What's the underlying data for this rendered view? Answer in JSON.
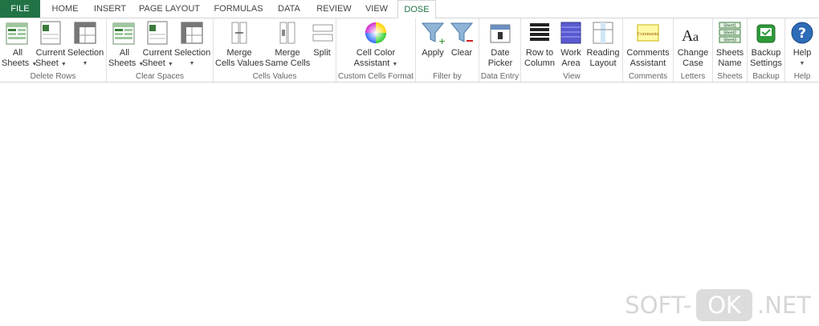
{
  "tabs": {
    "file": "FILE",
    "home": "HOME",
    "insert": "INSERT",
    "page_layout": "PAGE LAYOUT",
    "formulas": "FORMULAS",
    "data": "DATA",
    "review": "REVIEW",
    "view": "VIEW",
    "dose": "DOSE"
  },
  "groups": {
    "delete_rows": {
      "label": "Delete Rows",
      "all_sheets_1": "All",
      "all_sheets_2": "Sheets",
      "current_sheet_1": "Current",
      "current_sheet_2": "Sheet",
      "selection": "Selection"
    },
    "clear_spaces": {
      "label": "Clear Spaces",
      "all_sheets_1": "All",
      "all_sheets_2": "Sheets",
      "current_sheet_1": "Current",
      "current_sheet_2": "Sheet",
      "selection": "Selection"
    },
    "cells_values": {
      "label": "Cells Values",
      "merge_cells_1": "Merge",
      "merge_cells_2": "Cells Values",
      "merge_same_1": "Merge",
      "merge_same_2": "Same Cells",
      "split": "Split"
    },
    "custom_cells_format": {
      "label": "Custom Cells Format",
      "cell_color_1": "Cell Color",
      "cell_color_2": "Assistant"
    },
    "filter_by": {
      "label": "Filter by",
      "apply": "Apply",
      "clear": "Clear"
    },
    "data_entry": {
      "label": "Data Entry",
      "date_1": "Date",
      "date_2": "Picker"
    },
    "view": {
      "label": "View",
      "row_col_1": "Row to",
      "row_col_2": "Column",
      "work_1": "Work",
      "work_2": "Area",
      "reading_1": "Reading",
      "reading_2": "Layout"
    },
    "comments": {
      "label": "Comments",
      "btn_1": "Comments",
      "btn_2": "Assistant",
      "icon_text": "Comments"
    },
    "letters": {
      "label": "Letters",
      "btn_1": "Change",
      "btn_2": "Case"
    },
    "sheets": {
      "label": "Sheets",
      "btn_1": "Sheets",
      "btn_2": "Name",
      "icon_s1": "Sheet1",
      "icon_s2": "Sheet2",
      "icon_s3": "Sheet3"
    },
    "backup": {
      "label": "Backup",
      "btn_1": "Backup",
      "btn_2": "Settings"
    },
    "help": {
      "label": "Help",
      "btn_1": "Help"
    }
  },
  "watermark": {
    "left": "SOFT-",
    "ok": "OK",
    "right": ".NET"
  },
  "colors": {
    "file_tab": "#217346",
    "accent": "#217346",
    "ribbon_border": "#d4d4d4"
  }
}
